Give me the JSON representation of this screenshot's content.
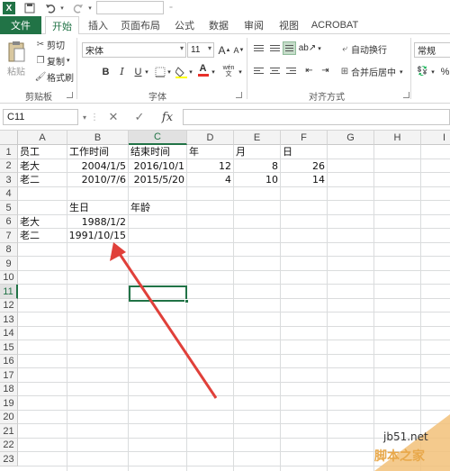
{
  "qat": {
    "logo": "X",
    "save_icon": "save-icon",
    "undo_icon": "undo-icon",
    "redo_icon": "redo-icon"
  },
  "tabs": [
    {
      "label": "文件"
    },
    {
      "label": "开始"
    },
    {
      "label": "插入"
    },
    {
      "label": "页面布局"
    },
    {
      "label": "公式"
    },
    {
      "label": "数据"
    },
    {
      "label": "审阅"
    },
    {
      "label": "视图"
    },
    {
      "label": "ACROBAT"
    }
  ],
  "ribbon": {
    "clipboard": {
      "paste": "粘贴",
      "cut": "剪切",
      "copy": "复制",
      "format_painter": "格式刷",
      "group_label": "剪贴板"
    },
    "font": {
      "font_name": "宋体",
      "font_size": "11",
      "bold": "B",
      "italic": "I",
      "underline": "U",
      "font_color_glyph": "A",
      "increase_font": "A",
      "decrease_font": "A",
      "phonetic": "wén",
      "group_label": "字体"
    },
    "alignment": {
      "wrap_text": "自动换行",
      "merge_center": "合并后居中",
      "group_label": "对齐方式"
    },
    "number": {
      "format": "常规",
      "percent": "%"
    }
  },
  "formula_bar": {
    "name_box": "C11",
    "cancel": "✕",
    "enter": "✓",
    "fx": "fx",
    "value": ""
  },
  "grid": {
    "columns": [
      "A",
      "B",
      "C",
      "D",
      "E",
      "F",
      "G",
      "H",
      "I"
    ],
    "rows": [
      "1",
      "2",
      "3",
      "4",
      "5",
      "6",
      "7",
      "8",
      "9",
      "10",
      "11",
      "12",
      "13",
      "14",
      "15",
      "16",
      "17",
      "18",
      "19",
      "20",
      "21",
      "22",
      "23"
    ],
    "selected_cell": "C11",
    "cells": {
      "A1": "员工",
      "B1": "工作时间",
      "C1": "结束时间",
      "D1": "年",
      "E1": "月",
      "F1": "日",
      "A2": "老大",
      "B2": "2004/1/5",
      "C2": "2016/10/1",
      "D2": "12",
      "E2": "8",
      "F2": "26",
      "A3": "老二",
      "B3": "2010/7/6",
      "C3": "2015/5/20",
      "D3": "4",
      "E3": "10",
      "F3": "14",
      "B5": "生日",
      "C5": "年龄",
      "A6": "老大",
      "B6": "1988/1/2",
      "A7": "老二",
      "B7": "1991/10/15"
    }
  },
  "watermark": {
    "site": "jb51.net",
    "logo": "脚本之家"
  }
}
